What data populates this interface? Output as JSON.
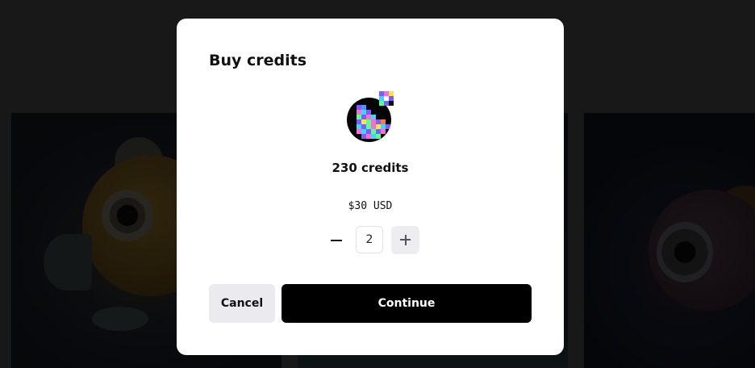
{
  "dialog": {
    "title": "Buy credits",
    "credits_label": "230 credits",
    "price_label": "$30 USD",
    "quantity": "2",
    "cancel_label": "Cancel",
    "continue_label": "Continue"
  },
  "avatar": {
    "icon": "pixel-art-avatar",
    "pixels": [
      "#7a5cff",
      "#5a8cff",
      "",
      "",
      "",
      "",
      "",
      "#ff6ad5",
      "#3cd6ff",
      "#7a5cff",
      "",
      "",
      "",
      "",
      "#5aff8c",
      "#7a5cff",
      "#ff6ad5",
      "#3cd6ff",
      "",
      "",
      "",
      "#7a5cff",
      "#ffe14a",
      "#5aff8c",
      "#ff6ad5",
      "#7a5cff",
      "#ff7a3c",
      "",
      "#3cd6ff",
      "#7a5cff",
      "#5aff8c",
      "#ff6ad5",
      "#ffe14a",
      "#3cd6ff",
      "#7a5cff",
      "#ff6ad5",
      "#3cd6ff",
      "#7a5cff",
      "#5aff8c",
      "#7a5cff",
      "#ff6ad5",
      "",
      "",
      "#7a5cff",
      "#ff6ad5",
      "#3cd6ff",
      "#5aff8c",
      "",
      ""
    ],
    "badge_pixels": [
      "#7a5cff",
      "#ff6ad5",
      "#ffe14a",
      "#3cd6ff",
      "#ffffff",
      "#7a5cff",
      "#5aff8c",
      "#7a5cff",
      "#111111"
    ]
  },
  "colors": {
    "backdrop": "#363636",
    "modal": "#ffffff",
    "primary_button": "#000000",
    "secondary_button": "#ebebef"
  }
}
